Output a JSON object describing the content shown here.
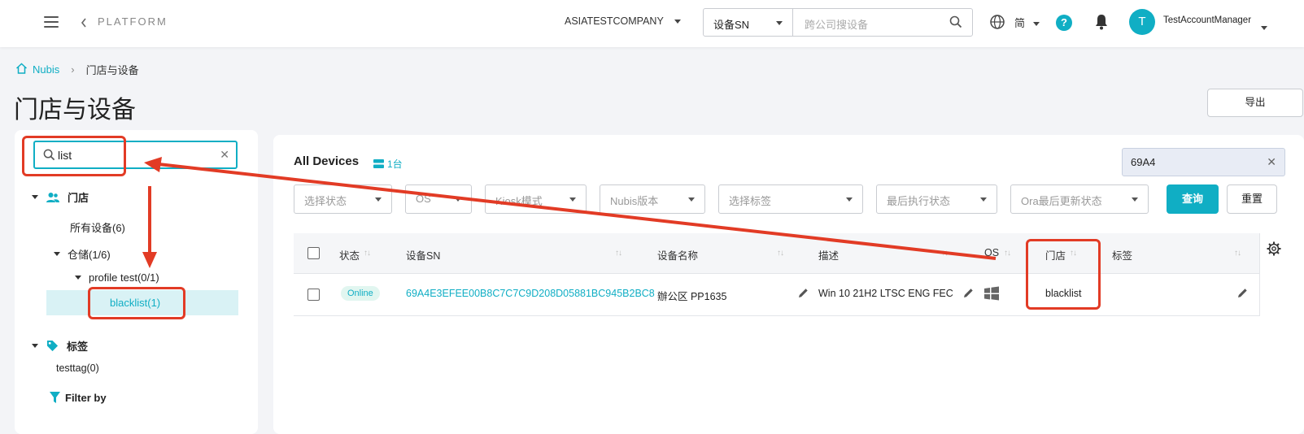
{
  "header": {
    "platform_label": "PLATFORM",
    "company": "ASIATESTCOMPANY",
    "search_type": "设备SN",
    "search_placeholder": "跨公司搜设备",
    "lang": "简",
    "help": "?",
    "avatar_letter": "T",
    "user_name": "TestAccountManager"
  },
  "breadcrumb": {
    "home": "Nubis",
    "current": "门店与设备"
  },
  "page_title": "门店与设备",
  "export_label": "导出",
  "sidebar": {
    "search_value": "list",
    "stores_label": "门店",
    "all_devices": "所有设备(6)",
    "warehouse": "仓储(1/6)",
    "profile": "profile test(0/1)",
    "selected": "blacklist(1)",
    "tags_label": "标签",
    "tag_item": "testtag(0)",
    "filter_by": "Filter by"
  },
  "main": {
    "title": "All Devices",
    "count": "1台",
    "quick_search": "69A4",
    "filters": [
      "选择状态",
      "OS",
      "Kiosk模式",
      "Nubis版本",
      "选择标签",
      "最后执行状态",
      "Ora最后更新状态"
    ],
    "query_label": "查询",
    "reset_label": "重置"
  },
  "table": {
    "columns": [
      "状态",
      "设备SN",
      "设备名称",
      "描述",
      "OS",
      "门店",
      "标签"
    ],
    "rows": [
      {
        "status": "Online",
        "sn": "69A4E3EFEE00B8C7C7C9D208D05881BC945B2BC8",
        "name": "辦公区 PP1635",
        "description": "Win 10 21H2 LTSC ENG FEC",
        "os": "windows-icon",
        "store": "blacklist",
        "tags": ""
      }
    ]
  },
  "colors": {
    "accent": "#10aec4",
    "annotation": "#e23b25"
  }
}
